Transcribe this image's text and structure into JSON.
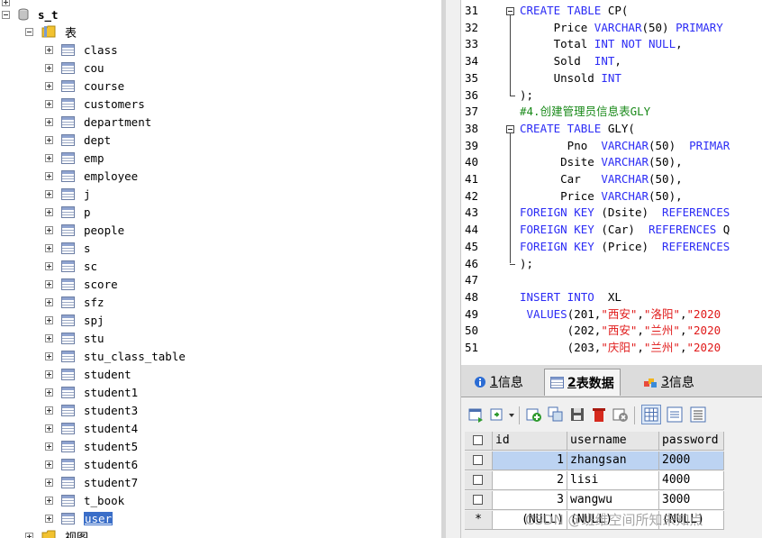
{
  "tree": {
    "database": "s_t",
    "tables_folder": "表",
    "views_folder": "视图",
    "tables": [
      "class",
      "cou",
      "course",
      "customers",
      "department",
      "dept",
      "emp",
      "employee",
      "j",
      "p",
      "people",
      "s",
      "sc",
      "score",
      "sfz",
      "spj",
      "stu",
      "stu_class_table",
      "student",
      "student1",
      "student3",
      "student4",
      "student5",
      "student6",
      "student7",
      "t_book",
      "user"
    ],
    "selected_table": "user"
  },
  "editor": {
    "lines": [
      {
        "n": "31",
        "fold": "start",
        "parts": [
          [
            "kw",
            "CREATE TABLE "
          ],
          [
            "tx",
            "CP("
          ]
        ]
      },
      {
        "n": "32",
        "parts": [
          [
            "tx",
            "     Price "
          ],
          [
            "kw",
            "VARCHAR"
          ],
          [
            "tx",
            "(50) "
          ],
          [
            "kw",
            "PRIMARY"
          ]
        ]
      },
      {
        "n": "33",
        "parts": [
          [
            "tx",
            "     Total "
          ],
          [
            "kw",
            "INT NOT NULL"
          ],
          [
            "tx",
            ","
          ]
        ]
      },
      {
        "n": "34",
        "parts": [
          [
            "tx",
            "     Sold  "
          ],
          [
            "kw",
            "INT"
          ],
          [
            "tx",
            ","
          ]
        ]
      },
      {
        "n": "35",
        "parts": [
          [
            "tx",
            "     Unsold "
          ],
          [
            "kw",
            "INT"
          ]
        ]
      },
      {
        "n": "36",
        "fold": "end",
        "parts": [
          [
            "tx",
            ");"
          ]
        ]
      },
      {
        "n": "37",
        "parts": [
          [
            "cm",
            "#4.创建管理员信息表GLY"
          ]
        ]
      },
      {
        "n": "38",
        "fold": "start",
        "parts": [
          [
            "kw",
            "CREATE TABLE "
          ],
          [
            "tx",
            "GLY("
          ]
        ]
      },
      {
        "n": "39",
        "parts": [
          [
            "tx",
            "       Pno  "
          ],
          [
            "kw",
            "VARCHAR"
          ],
          [
            "tx",
            "(50)  "
          ],
          [
            "kw",
            "PRIMAR"
          ]
        ]
      },
      {
        "n": "40",
        "parts": [
          [
            "tx",
            "      Dsite "
          ],
          [
            "kw",
            "VARCHAR"
          ],
          [
            "tx",
            "(50),"
          ]
        ]
      },
      {
        "n": "41",
        "parts": [
          [
            "tx",
            "      Car   "
          ],
          [
            "kw",
            "VARCHAR"
          ],
          [
            "tx",
            "(50),"
          ]
        ]
      },
      {
        "n": "42",
        "parts": [
          [
            "tx",
            "      Price "
          ],
          [
            "kw",
            "VARCHAR"
          ],
          [
            "tx",
            "(50),"
          ]
        ]
      },
      {
        "n": "43",
        "parts": [
          [
            "kw",
            "FOREIGN KEY "
          ],
          [
            "tx",
            "(Dsite)  "
          ],
          [
            "kw",
            "REFERENCES"
          ]
        ]
      },
      {
        "n": "44",
        "parts": [
          [
            "kw",
            "FOREIGN KEY "
          ],
          [
            "tx",
            "(Car)  "
          ],
          [
            "kw",
            "REFERENCES "
          ],
          [
            "tx",
            "Q"
          ]
        ]
      },
      {
        "n": "45",
        "parts": [
          [
            "kw",
            "FOREIGN KEY "
          ],
          [
            "tx",
            "(Price)  "
          ],
          [
            "kw",
            "REFERENCES"
          ]
        ]
      },
      {
        "n": "46",
        "fold": "end",
        "parts": [
          [
            "tx",
            ");"
          ]
        ]
      },
      {
        "n": "47",
        "parts": []
      },
      {
        "n": "48",
        "parts": [
          [
            "kw",
            "INSERT INTO "
          ],
          [
            "tx",
            " XL"
          ]
        ]
      },
      {
        "n": "49",
        "parts": [
          [
            "kw",
            " VALUES"
          ],
          [
            "tx",
            "(201,"
          ],
          [
            "str",
            "\"西安\""
          ],
          [
            "tx",
            ","
          ],
          [
            "str",
            "\"洛阳\""
          ],
          [
            "tx",
            ","
          ],
          [
            "str",
            "\"2020"
          ]
        ]
      },
      {
        "n": "50",
        "parts": [
          [
            "tx",
            "       (202,"
          ],
          [
            "str",
            "\"西安\""
          ],
          [
            "tx",
            ","
          ],
          [
            "str",
            "\"兰州\""
          ],
          [
            "tx",
            ","
          ],
          [
            "str",
            "\"2020"
          ]
        ]
      },
      {
        "n": "51",
        "parts": [
          [
            "tx",
            "       (203,"
          ],
          [
            "str",
            "\"庆阳\""
          ],
          [
            "tx",
            ","
          ],
          [
            "str",
            "\"兰州\""
          ],
          [
            "tx",
            ","
          ],
          [
            "str",
            "\"2020"
          ]
        ]
      }
    ]
  },
  "panel": {
    "tabs": [
      {
        "num": "1",
        "label": " 信息"
      },
      {
        "num": "2",
        "label": " 表数据"
      },
      {
        "num": "3",
        "label": " 信息"
      }
    ],
    "active_tab": 1,
    "columns": [
      "id",
      "username",
      "password"
    ],
    "rows": [
      {
        "id": "1",
        "username": "zhangsan",
        "password": "2000"
      },
      {
        "id": "2",
        "username": "lisi",
        "password": "4000"
      },
      {
        "id": "3",
        "username": "wangwu",
        "password": "3000"
      }
    ],
    "new_row": {
      "id": "(NULL)",
      "username": "(NULL)",
      "password": "(NULL)",
      "marker": "*"
    }
  },
  "watermark": "CSDN @班维空间所知未知点"
}
